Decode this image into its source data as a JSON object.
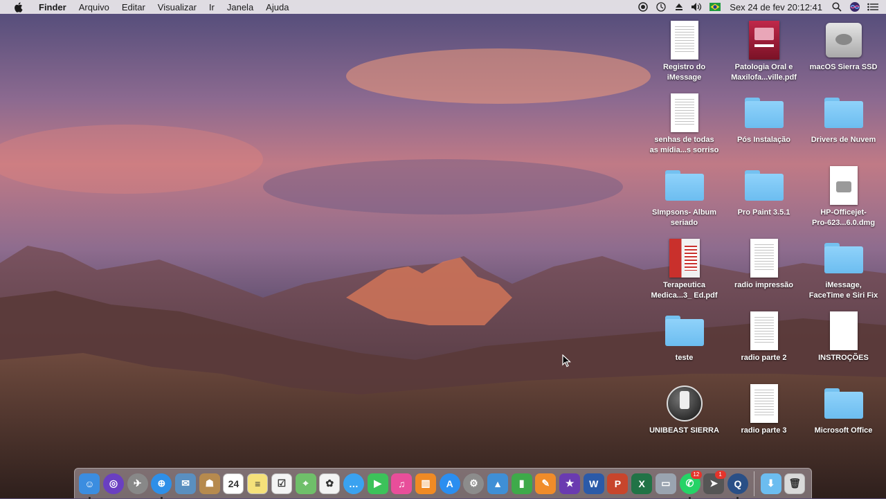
{
  "menubar": {
    "app_name": "Finder",
    "menus": [
      "Arquivo",
      "Editar",
      "Visualizar",
      "Ir",
      "Janela",
      "Ajuda"
    ],
    "clock": "Sex 24 de fev  20:12:41",
    "status_icons": [
      "screen-record-icon",
      "time-machine-icon",
      "eject-icon",
      "volume-icon",
      "brazil-flag-icon",
      "search-icon",
      "siri-icon",
      "notification-center-icon"
    ]
  },
  "desktop": {
    "icons": [
      {
        "label": "Registro do\niMessage",
        "type": "doc"
      },
      {
        "label": "Patologia Oral e\nMaxilofa...ville.pdf",
        "type": "book"
      },
      {
        "label": "macOS Sierra SSD",
        "type": "disk"
      },
      {
        "label": "senhas de todas\nas mídia...s sorriso",
        "type": "doc"
      },
      {
        "label": "Pós Instalação",
        "type": "folder"
      },
      {
        "label": "Drivers de Nuvem",
        "type": "folder"
      },
      {
        "label": "SImpsons- Album\nseriado",
        "type": "folder"
      },
      {
        "label": "Pro Paint 3.5.1",
        "type": "folder"
      },
      {
        "label": "HP-Officejet-\nPro-623...6.0.dmg",
        "type": "dmg"
      },
      {
        "label": "Terapeutica\nMedica...3_ Ed.pdf",
        "type": "book2"
      },
      {
        "label": "radio impressão",
        "type": "doc"
      },
      {
        "label": "iMessage,\nFaceTime e Siri Fix",
        "type": "folder"
      },
      {
        "label": "teste",
        "type": "folder"
      },
      {
        "label": "radio parte 2",
        "type": "doc"
      },
      {
        "label": "INSTROÇÕES",
        "type": "blank"
      },
      {
        "label": "UNIBEAST SIERRA",
        "type": "usb"
      },
      {
        "label": "radio parte 3",
        "type": "doc"
      },
      {
        "label": "Microsoft Office",
        "type": "folder"
      }
    ]
  },
  "dock": {
    "apps": [
      {
        "name": "finder-icon",
        "color": "#3b8de0",
        "glyph": "☺",
        "running": true
      },
      {
        "name": "siri-icon",
        "color": "#6a3fc1",
        "glyph": "◎",
        "running": false
      },
      {
        "name": "launchpad-icon",
        "color": "#888888",
        "glyph": "✈",
        "running": false
      },
      {
        "name": "safari-icon",
        "color": "#2e8fe8",
        "glyph": "⊕",
        "running": true
      },
      {
        "name": "mail-stamp-icon",
        "color": "#5a8fc0",
        "glyph": "✉",
        "running": false
      },
      {
        "name": "contacts-icon",
        "color": "#b68a4e",
        "glyph": "☗",
        "running": false
      },
      {
        "name": "calendar-icon",
        "color": "#ffffff",
        "glyph": "24",
        "running": false
      },
      {
        "name": "notes-icon",
        "color": "#f5e17a",
        "glyph": "≡",
        "running": false
      },
      {
        "name": "reminders-icon",
        "color": "#f4f4f4",
        "glyph": "☑",
        "running": false
      },
      {
        "name": "maps-icon",
        "color": "#6fbf6a",
        "glyph": "⌖",
        "running": false
      },
      {
        "name": "photos-icon",
        "color": "#f3f3f3",
        "glyph": "✿",
        "running": false
      },
      {
        "name": "messages-icon",
        "color": "#3aa2f0",
        "glyph": "…",
        "running": false
      },
      {
        "name": "facetime-icon",
        "color": "#3cc25a",
        "glyph": "▶",
        "running": false
      },
      {
        "name": "itunes-icon",
        "color": "#e84e9a",
        "glyph": "♫",
        "running": false
      },
      {
        "name": "ibooks-icon",
        "color": "#f08a24",
        "glyph": "▥",
        "running": false
      },
      {
        "name": "app-store-icon",
        "color": "#2b8ef0",
        "glyph": "A",
        "running": false
      },
      {
        "name": "system-preferences-icon",
        "color": "#8c8c8c",
        "glyph": "⚙",
        "running": false
      },
      {
        "name": "keynote-icon",
        "color": "#3f8fd6",
        "glyph": "▲",
        "running": false
      },
      {
        "name": "numbers-icon",
        "color": "#3eaa4a",
        "glyph": "▮",
        "running": false
      },
      {
        "name": "pages-icon",
        "color": "#f08c2a",
        "glyph": "✎",
        "running": false
      },
      {
        "name": "imovie-icon",
        "color": "#6a3bb0",
        "glyph": "★",
        "running": false
      },
      {
        "name": "word-icon",
        "color": "#2b5aa8",
        "glyph": "W",
        "running": false
      },
      {
        "name": "powerpoint-icon",
        "color": "#c8452c",
        "glyph": "P",
        "running": false
      },
      {
        "name": "excel-icon",
        "color": "#217346",
        "glyph": "X",
        "running": false
      },
      {
        "name": "disk-utility-icon",
        "color": "#9aa4b0",
        "glyph": "▭",
        "running": false
      },
      {
        "name": "whatsapp-icon",
        "color": "#25d366",
        "glyph": "✆",
        "running": true,
        "badge": "12"
      },
      {
        "name": "airmail-icon",
        "color": "#555555",
        "glyph": "➤",
        "running": false,
        "badge": "1"
      },
      {
        "name": "quicktime-icon",
        "color": "#2a4f86",
        "glyph": "Q",
        "running": true
      }
    ],
    "right_items": [
      {
        "name": "downloads-folder-icon",
        "color": "#6cbdf0",
        "glyph": "⬇"
      },
      {
        "name": "trash-icon",
        "color": "#d9d9d9",
        "glyph": "🗑"
      }
    ]
  }
}
